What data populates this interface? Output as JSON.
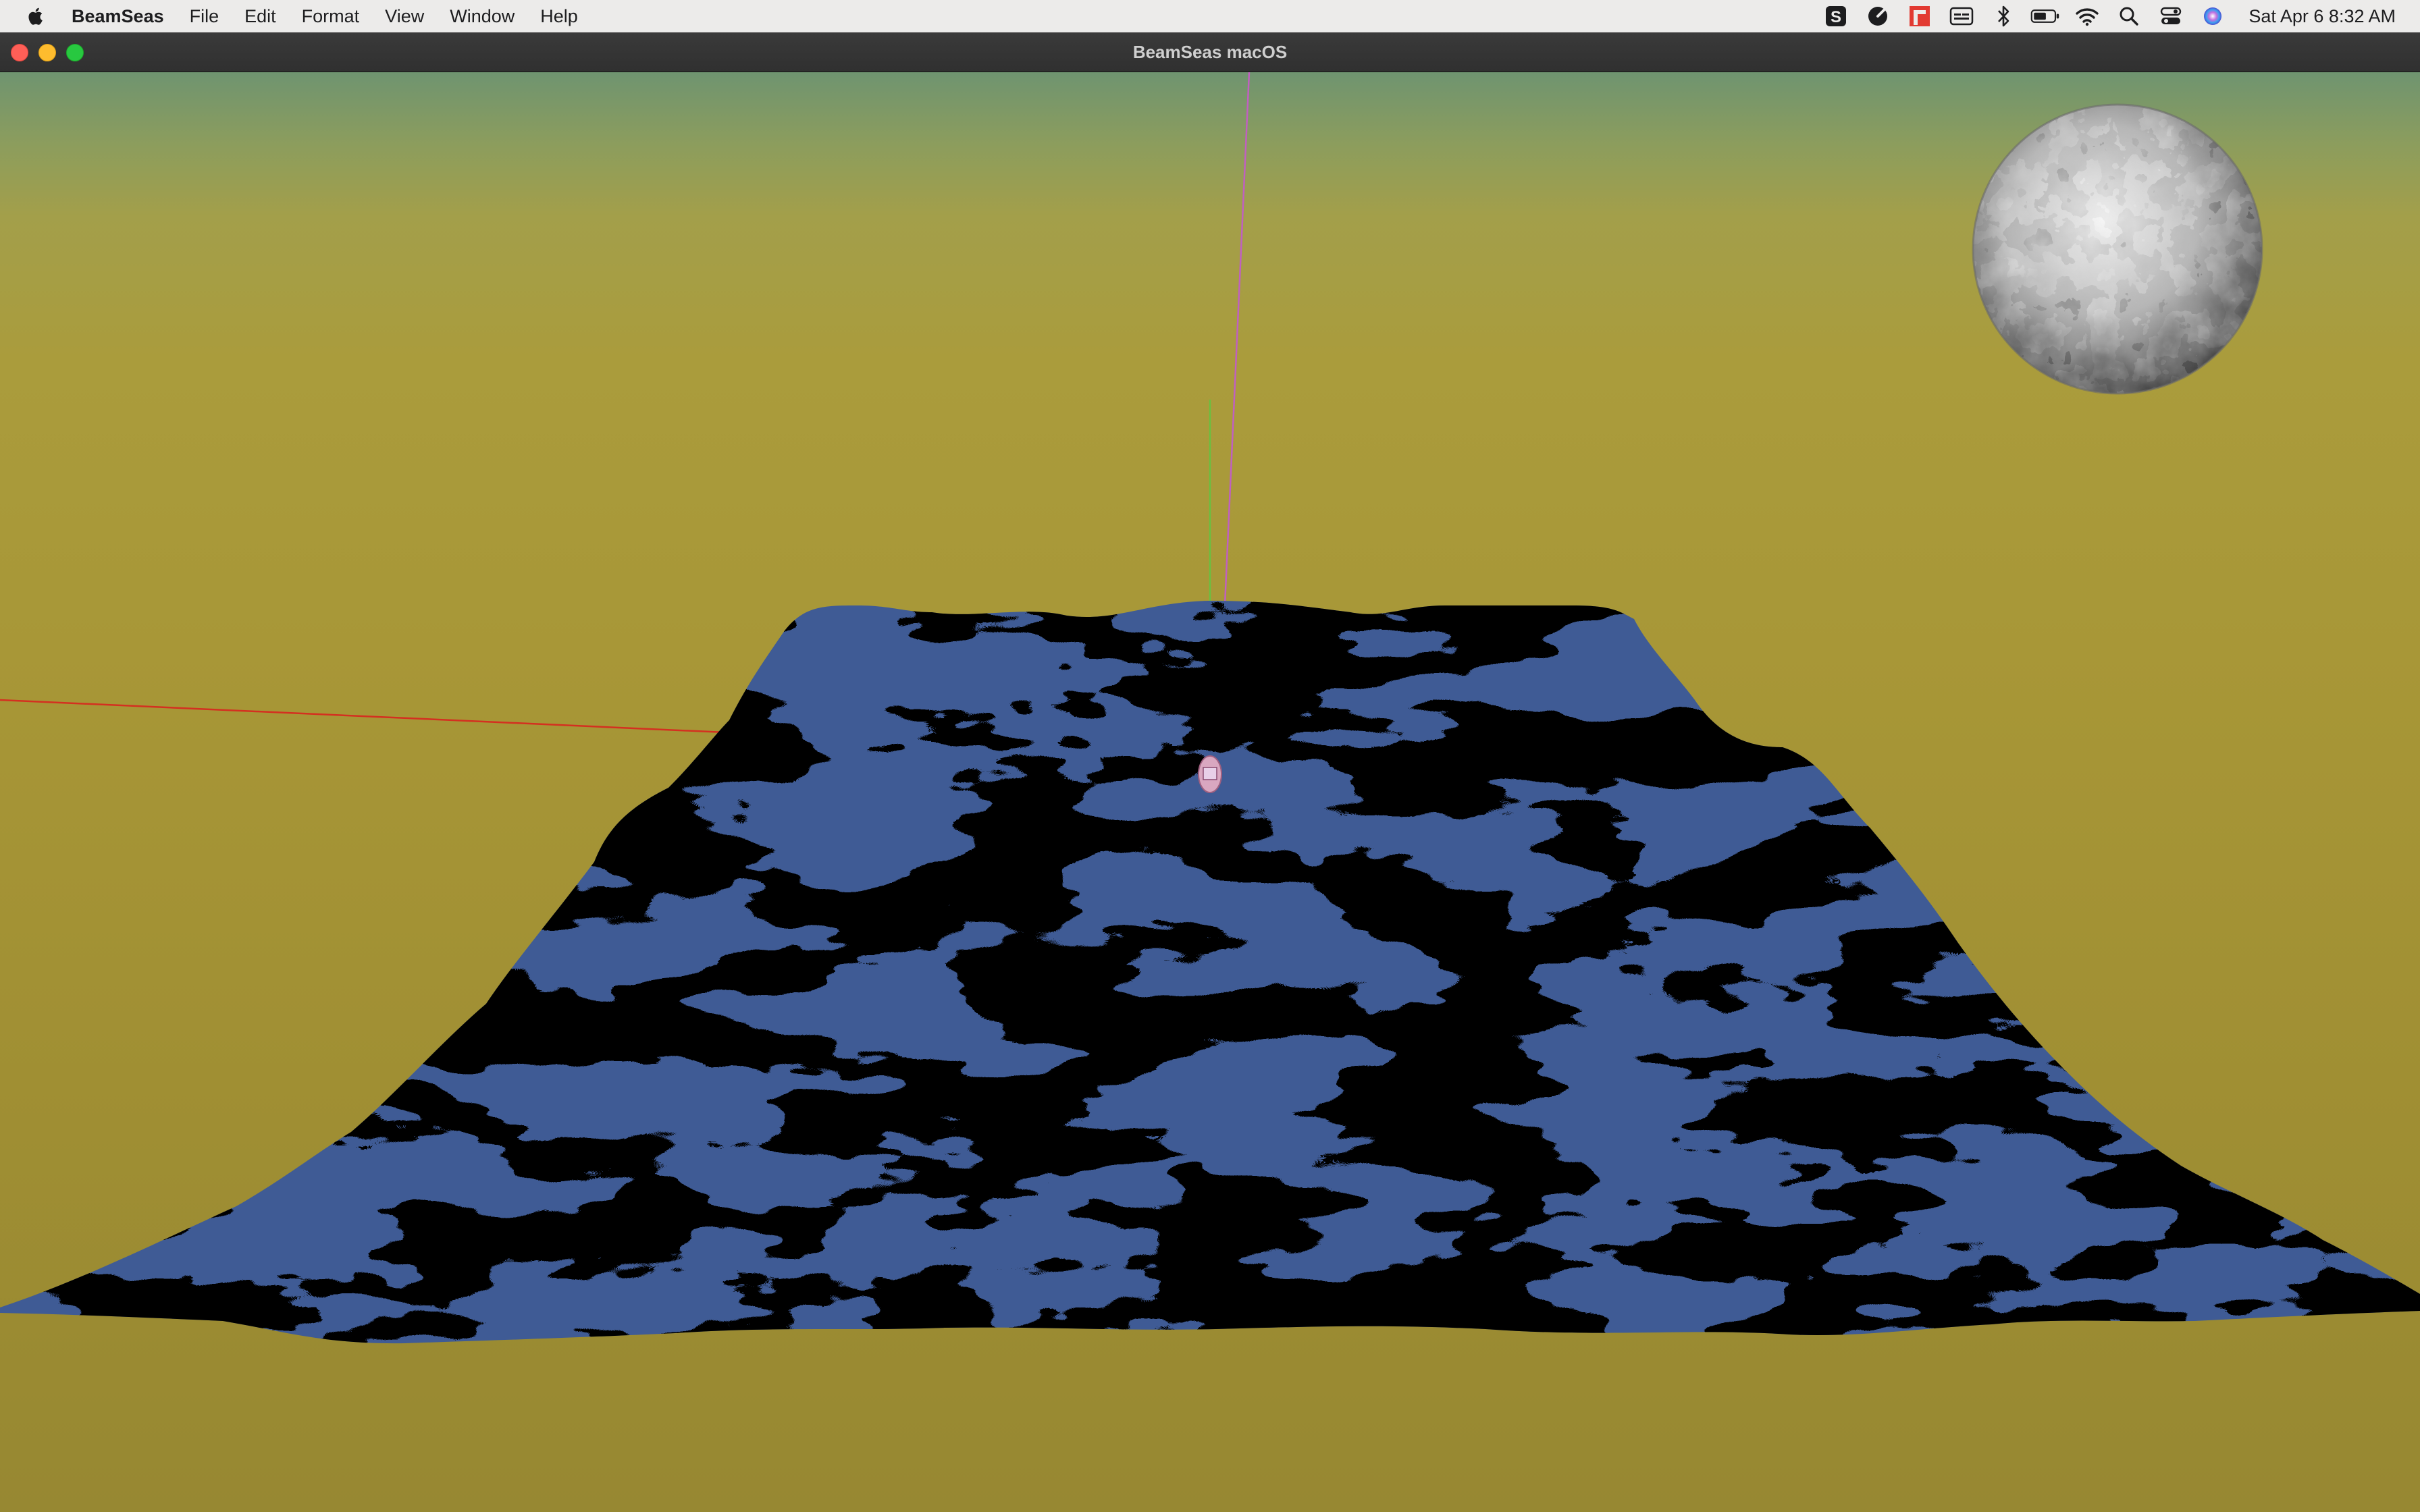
{
  "menubar": {
    "app_name": "BeamSeas",
    "items": [
      "File",
      "Edit",
      "Format",
      "View",
      "Window",
      "Help"
    ],
    "status_icons": [
      "scrobbles-icon",
      "speedometer-icon",
      "red-app-icon",
      "captions-icon",
      "bluetooth-icon",
      "battery-icon",
      "wifi-icon",
      "search-icon",
      "control-center-icon",
      "siri-icon"
    ],
    "clock": "Sat Apr 6  8:32 AM"
  },
  "window": {
    "title": "BeamSeas macOS"
  },
  "scene": {
    "sky_top_color": "#6f9470",
    "sky_color": "#aa9c3c",
    "water_color": "#3f5b95",
    "shadow_color": "#000000",
    "axis_x_color": "#d43020",
    "axis_y_color": "#6ac040",
    "axis_z_color": "#c060c0"
  }
}
